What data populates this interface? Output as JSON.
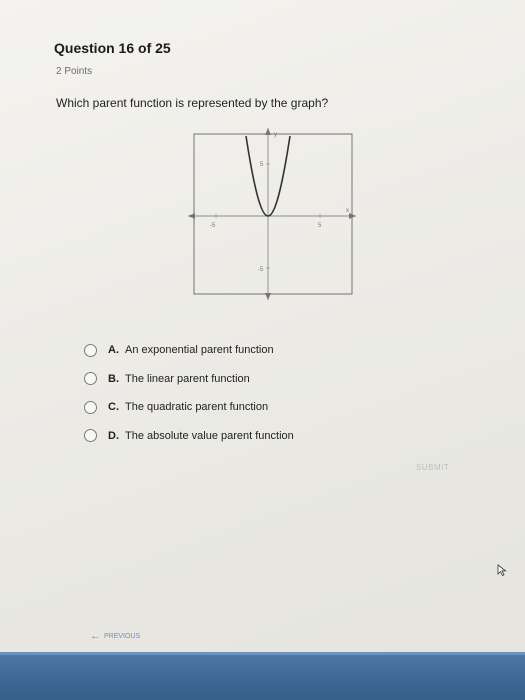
{
  "question": {
    "title": "Question 16 of 25",
    "points": "2 Points",
    "text": "Which parent function is represented by the graph?"
  },
  "graph": {
    "y_label": "y",
    "x_label": "x",
    "x_tick_neg": "-5",
    "x_tick_pos": "5",
    "y_tick_pos": "5",
    "y_tick_neg": "-5"
  },
  "options": [
    {
      "letter": "A.",
      "text": "An exponential parent function"
    },
    {
      "letter": "B.",
      "text": "The linear parent function"
    },
    {
      "letter": "C.",
      "text": "The quadratic parent function"
    },
    {
      "letter": "D.",
      "text": "The absolute value parent function"
    }
  ],
  "actions": {
    "submit": "SUBMIT",
    "previous": "PREVIOUS"
  }
}
